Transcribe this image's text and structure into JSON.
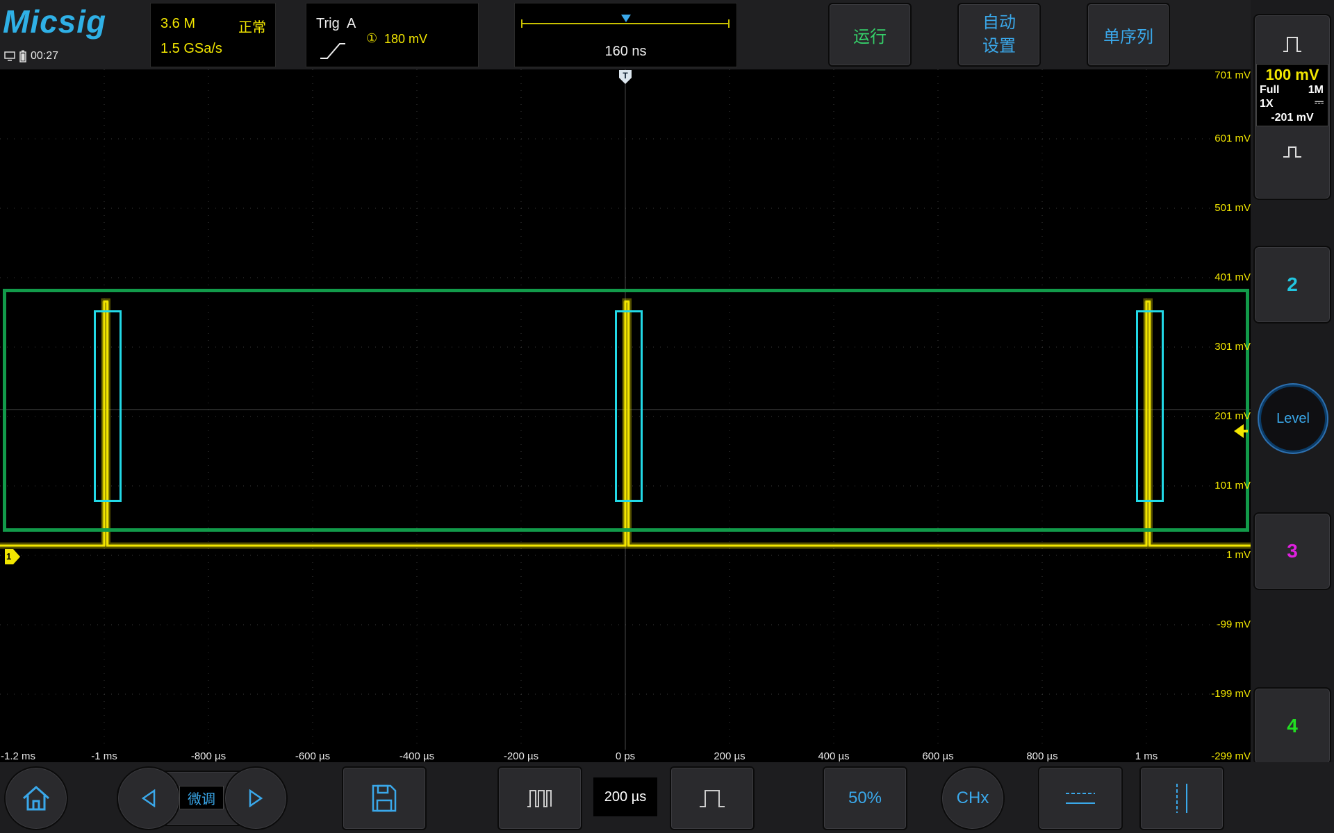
{
  "brand": "Micsig",
  "status": {
    "clock": "00:27"
  },
  "acquisition": {
    "memory_depth": "3.6 M",
    "mode": "正常",
    "sample_rate": "1.5 GSa/s"
  },
  "trigger": {
    "label": "Trig",
    "source_letter": "A",
    "channel_marker": "①",
    "level": "180 mV"
  },
  "timebase_panel": {
    "delay": "160 ns"
  },
  "top_buttons": {
    "run": "运行",
    "auto_line1": "自动",
    "auto_line2": "设置",
    "single": "单序列"
  },
  "channel1": {
    "scale": "100 mV",
    "bandwidth": "Full",
    "impedance": "1M",
    "probe": "1X",
    "coupling": "⎓",
    "offset": "-201 mV",
    "marker": "1"
  },
  "trigger_marker": "T",
  "right_buttons": {
    "ch2": "2",
    "level": "Level",
    "ch3": "3",
    "ch4": "4"
  },
  "y_axis_labels": [
    "701 mV",
    "601 mV",
    "501 mV",
    "401 mV",
    "301 mV",
    "201 mV",
    "101 mV",
    "1 mV",
    "-99 mV",
    "-199 mV",
    "-299 mV"
  ],
  "x_axis_labels": [
    "-1.2 ms",
    "-1 ms",
    "-800 µs",
    "-600 µs",
    "-400 µs",
    "-200 µs",
    "0 ps",
    "200 µs",
    "400 µs",
    "600 µs",
    "800 µs",
    "1 ms"
  ],
  "bottom": {
    "fine_tune": "微调",
    "timebase": "200 µs",
    "fifty_percent": "50%",
    "chx": "CHx"
  },
  "colors": {
    "ch1": "#f2e600",
    "ch2": "#22c6e0",
    "ch3": "#e020e0",
    "ch4": "#22dd22",
    "accent": "#3aa8ea",
    "highlight_green": "#129a4a",
    "highlight_cyan": "#22d8e6"
  },
  "chart_data": {
    "type": "line",
    "title": "",
    "xlabel": "",
    "ylabel": "",
    "xlim_us": [
      -1200,
      1200
    ],
    "ylim_mV": [
      -299,
      701
    ],
    "series": [
      {
        "name": "1",
        "x": [
          -1200,
          -1000,
          -1000,
          -994,
          -994,
          0,
          0,
          6,
          6,
          1000,
          1000,
          1006,
          1006,
          1200
        ],
        "y": [
          1,
          1,
          360,
          360,
          1,
          1,
          360,
          360,
          1,
          1,
          360,
          360,
          1,
          1
        ]
      }
    ]
  }
}
